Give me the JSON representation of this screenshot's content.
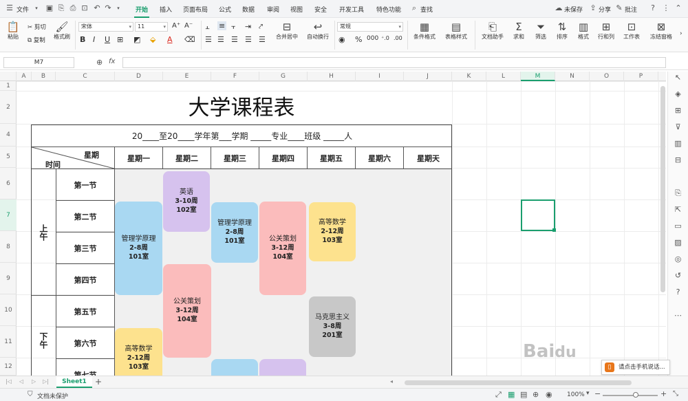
{
  "menu": {
    "file": "文件",
    "tabs": [
      "开始",
      "插入",
      "页面布局",
      "公式",
      "数据",
      "审阅",
      "视图",
      "安全",
      "开发工具",
      "特色功能"
    ],
    "active_tab": "开始",
    "search": "查找",
    "unsaved": "未保存",
    "share": "分享",
    "comment": "批注"
  },
  "ribbon": {
    "paste": "粘贴",
    "cut": "剪切",
    "copy": "复制",
    "format_painter": "格式刷",
    "font_name": "宋体",
    "font_size": "11",
    "merge_center": "合并居中",
    "wrap_text": "自动换行",
    "number_format": "常规",
    "conditional_format": "条件格式",
    "table_style": "表格样式",
    "doc_helper": "文档助手",
    "sum": "求和",
    "filter": "筛选",
    "sort": "排序",
    "format": "格式",
    "rows_cols": "行和列",
    "worksheet": "工作表",
    "freeze": "冻结窗格"
  },
  "formula_bar": {
    "cell_ref": "M7",
    "fx": "fx",
    "value": ""
  },
  "columns": [
    "A",
    "B",
    "C",
    "D",
    "E",
    "F",
    "G",
    "H",
    "I",
    "J",
    "K",
    "L",
    "M",
    "N",
    "O",
    "P"
  ],
  "selected_column": "M",
  "rows": [
    "1",
    "2",
    "4",
    "5",
    "6",
    "7",
    "8",
    "9",
    "10",
    "11",
    "12"
  ],
  "selected_row": "7",
  "schedule": {
    "title": "大学课程表",
    "info_line": "20____至20____学年第___学期 _____专业____班级 _____人",
    "header_top": "星期",
    "header_bottom": "时间",
    "days": [
      "星期一",
      "星期二",
      "星期三",
      "星期四",
      "星期五",
      "星期六",
      "星期天"
    ],
    "morning": "上午",
    "afternoon": "下午",
    "periods": [
      "第一节",
      "第二节",
      "第三节",
      "第四节",
      "第五节",
      "第六节",
      "第七节"
    ],
    "courses": [
      {
        "name": "英语",
        "weeks": "3-10周",
        "room": "102室",
        "color": "#d6c2ee"
      },
      {
        "name": "管理学原理",
        "weeks": "2-8周",
        "room": "101室",
        "color": "#a9d8f2"
      },
      {
        "name": "管理学原理",
        "weeks": "2-8周",
        "room": "101室",
        "color": "#a9d8f2"
      },
      {
        "name": "公关策划",
        "weeks": "3-12周",
        "room": "104室",
        "color": "#fbbcbc"
      },
      {
        "name": "高等数学",
        "weeks": "2-12周",
        "room": "103室",
        "color": "#fde28e"
      },
      {
        "name": "公关策划",
        "weeks": "3-12周",
        "room": "104室",
        "color": "#fbbcbc"
      },
      {
        "name": "马克思主义",
        "weeks": "3-8周",
        "room": "201室",
        "color": "#c8c8c8"
      },
      {
        "name": "高等数学",
        "weeks": "2-12周",
        "room": "103室",
        "color": "#fde28e"
      }
    ]
  },
  "sheet_tab": "Sheet1",
  "status": {
    "doc_unprotected": "文档未保护",
    "zoom": "100%"
  },
  "popup": {
    "text": "请点击手机说话..."
  }
}
